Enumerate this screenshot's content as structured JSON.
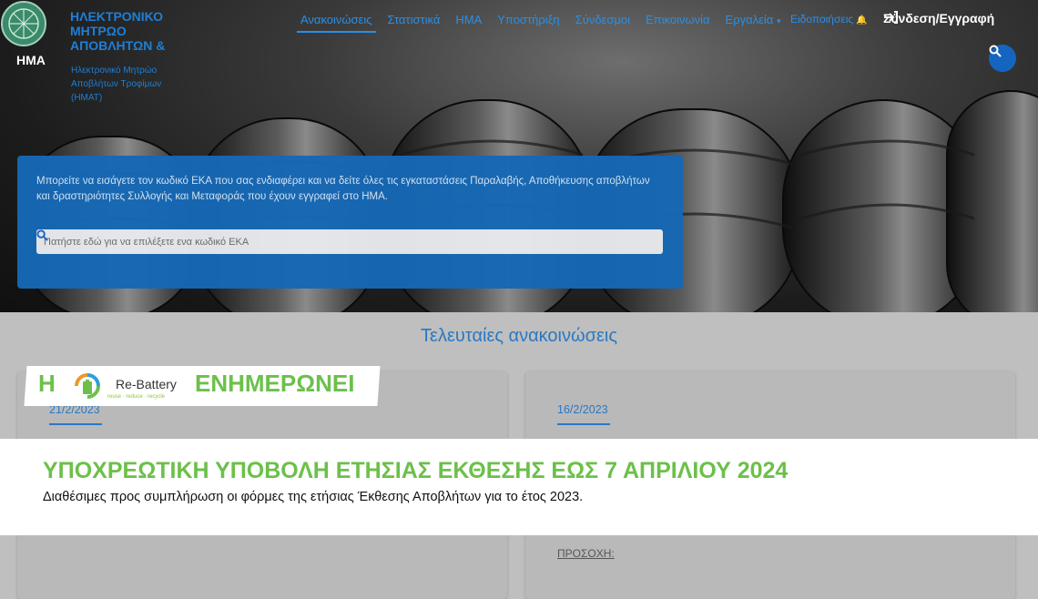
{
  "brand": {
    "logo_text": "HMA",
    "title": "ΗΛΕΚΤΡΟΝΙΚΟ ΜΗΤΡΩΟ ΑΠΟΒΛΗΤΩΝ &",
    "subtitle": "Ηλεκτρονικό Μητρώο Αποβλήτων Τροφίμων (ΗΜΑΤ)"
  },
  "nav": {
    "items": [
      {
        "label": "Ανακοινώσεις",
        "active": true
      },
      {
        "label": "Στατιστικά"
      },
      {
        "label": "ΗΜΑ"
      },
      {
        "label": "Υποστήριξη"
      },
      {
        "label": "Σύνδεσμοι"
      },
      {
        "label": "Επικοινωνία"
      },
      {
        "label": "Εργαλεία"
      }
    ],
    "notifications": "Ειδοποιήσεις",
    "login": "Σύνδεση/Εγγραφή"
  },
  "info": {
    "text": "Μπορείτε να εισάγετε τον κωδικό ΕΚΑ που σας ενδιαφέρει και να δείτε όλες τις εγκαταστάσεις Παραλαβής, Αποθήκευσης αποβλήτων και δραστηριότητες Συλλογής και Μεταφοράς που έχουν εγγραφεί στο ΗΜΑ.",
    "placeholder": "Πατήστε εδώ για να επιλέξετε ενα κωδικό ΕΚΑ"
  },
  "announcements": {
    "title": "Τελευταίες ανακοινώσεις",
    "cards": [
      {
        "date": "21/2/2023"
      },
      {
        "date": "16/2/2023",
        "note": "ΠΡΟΣΟΧΗ:"
      }
    ]
  },
  "rebattery": {
    "prefix": "Η",
    "name": "Re-Battery",
    "tagline": "reuse · reduce · recycle",
    "suffix": "ΕΝΗΜΕΡΩΝΕΙ"
  },
  "banner": {
    "title": "ΥΠΟΧΡΕΩΤΙΚΗ ΥΠΟΒΟΛΗ ΕΤΗΣΙΑΣ ΕΚΘΕΣΗΣ ΕΩΣ 7 ΑΠΡΙΛΙΟΥ 2024",
    "subtitle": "Διαθέσιμες  προς συμπλήρωση οι φόρμες της ετήσιας Έκθεσης Αποβλήτων για το έτος 2023."
  },
  "colors": {
    "accent": "#1e7fd6",
    "info_box": "#1668b5",
    "green": "#6cc04a"
  }
}
